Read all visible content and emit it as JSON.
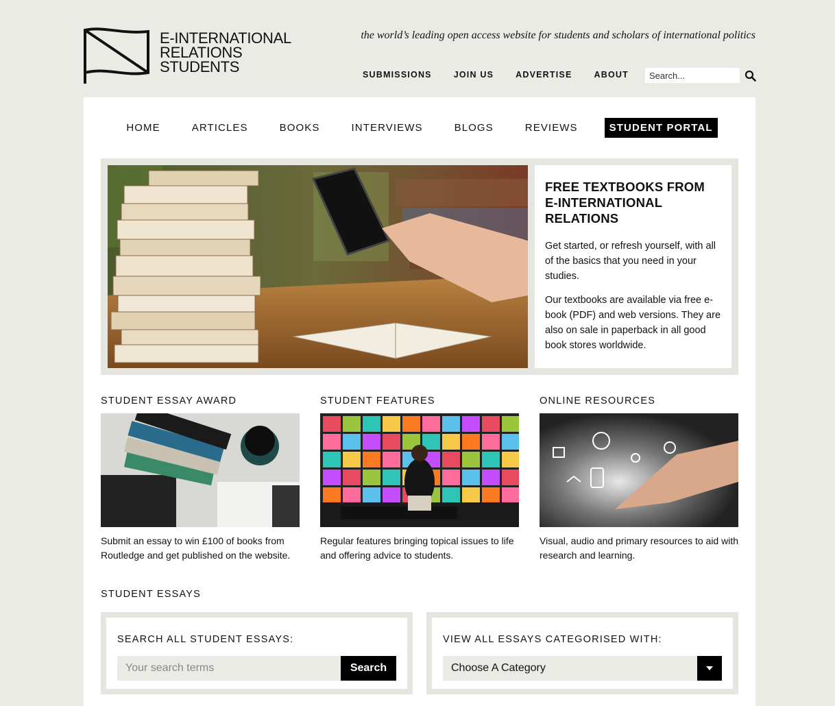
{
  "logo": {
    "line1": "E-INTERNATIONAL",
    "line2": "RELATIONS",
    "line3": "STUDENTS"
  },
  "tagline": "the world’s leading open access website for students and scholars of international politics",
  "top_nav": [
    "SUBMISSIONS",
    "JOIN US",
    "ADVERTISE",
    "ABOUT"
  ],
  "top_search": {
    "placeholder": "Search...",
    "icon": "search-icon"
  },
  "main_nav": {
    "items": [
      "HOME",
      "ARTICLES",
      "BOOKS",
      "INTERVIEWS",
      "BLOGS",
      "REVIEWS",
      "STUDENT PORTAL"
    ],
    "active": "STUDENT PORTAL"
  },
  "feature": {
    "title_line1": "FREE TEXTBOOKS FROM",
    "title_line2": "E-INTERNATIONAL",
    "title_line3": "RELATIONS",
    "para1": "Get started, or refresh yourself, with all of the basics that you need in your studies.",
    "para2": "Our textbooks are available via free e-book (PDF) and web versions. They are also on sale in paperback in all good book stores worldwide."
  },
  "columns": [
    {
      "title": "STUDENT ESSAY AWARD",
      "text": "Submit an essay to win £100 of books from Routledge and get published on the website."
    },
    {
      "title": "STUDENT FEATURES",
      "text": "Regular features bringing topical issues to life and offering advice to students."
    },
    {
      "title": "ONLINE RESOURCES",
      "text": "Visual, audio and primary resources to aid with research and learning."
    }
  ],
  "essays": {
    "section_title": "STUDENT ESSAYS",
    "search_label": "SEARCH ALL STUDENT ESSAYS:",
    "search_placeholder": "Your search terms",
    "search_button": "Search",
    "category_label": "VIEW ALL ESSAYS CATEGORISED WITH:",
    "category_selected": "Choose A Category"
  },
  "colors": {
    "background": "#ebebe6",
    "panel": "#ffffff",
    "accent": "#000000",
    "box": "#e6e6e1"
  }
}
